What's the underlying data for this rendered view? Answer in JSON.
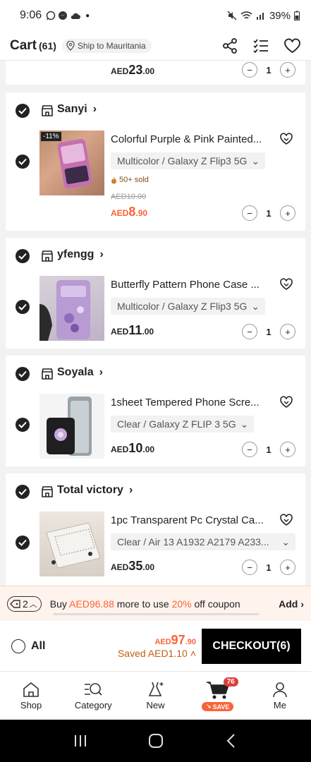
{
  "status_bar": {
    "time": "9:06",
    "battery": "39%"
  },
  "header": {
    "title": "Cart",
    "count": "(61)",
    "ship_to": "Ship to Mauritania"
  },
  "prev_item": {
    "price_cur": "AED",
    "price_int": "23",
    "price_dec": ".00",
    "qty": "1"
  },
  "stores": [
    {
      "name": "Sanyi",
      "product": "Colorful Purple & Pink Painted...",
      "variant": "Multicolor / Galaxy Z Flip3 5G",
      "discount": "-11%",
      "sold": "50+ sold",
      "old_price": "AED10.00",
      "price_cur": "AED",
      "price_int": "8",
      "price_dec": ".90",
      "qty": "1"
    },
    {
      "name": "yfengg",
      "product": "Butterfly Pattern Phone Case ...",
      "variant": "Multicolor / Galaxy Z Flip3 5G",
      "price_cur": "AED",
      "price_int": "11",
      "price_dec": ".00",
      "qty": "1"
    },
    {
      "name": "Soyala",
      "product": "1sheet Tempered Phone Scre...",
      "variant": "Clear / Galaxy Z FLIP 3 5G",
      "price_cur": "AED",
      "price_int": "10",
      "price_dec": ".00",
      "qty": "1"
    },
    {
      "name": "Total victory",
      "product": "1pc Transparent Pc Crystal Ca...",
      "variant": "Clear / Air 13 A1932 A2179 A233...",
      "price_cur": "AED",
      "price_int": "35",
      "price_dec": ".00",
      "qty": "1"
    }
  ],
  "coupon": {
    "count": "2",
    "prefix": "Buy ",
    "amount": "AED96.88",
    "mid": " more to use ",
    "pct": "20%",
    "suffix": " off coupon",
    "add": "Add"
  },
  "checkout": {
    "all_label": "All",
    "total_cur": "AED",
    "total_int": "97",
    "total_dec": ".90",
    "saved": "Saved AED1.10",
    "button": "CHECKOUT(6)"
  },
  "tabs": [
    {
      "label": "Shop",
      "icon": "home-icon"
    },
    {
      "label": "Category",
      "icon": "category-search-icon"
    },
    {
      "label": "New",
      "icon": "dress-sparkle-icon"
    },
    {
      "label": "",
      "icon": "cart-icon",
      "badge": "76",
      "tag": "SAVE"
    },
    {
      "label": "Me",
      "icon": "person-icon"
    }
  ],
  "colors": {
    "accent": "#fa6338",
    "primary": "#000000",
    "badge": "#e13d3d"
  }
}
